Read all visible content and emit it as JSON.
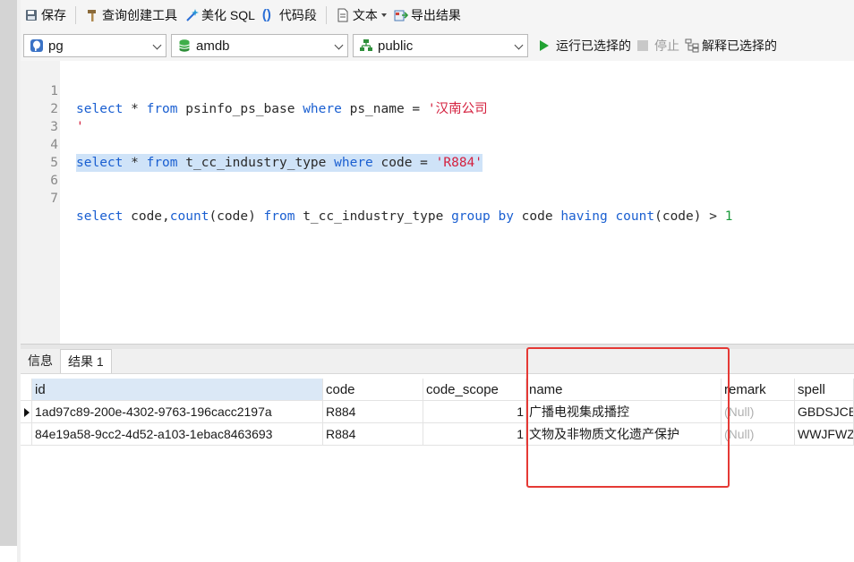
{
  "toolbar": {
    "save": "保存",
    "query_builder": "查询创建工具",
    "beautify_sql": "美化 SQL",
    "code_snippet": "代码段",
    "text": "文本",
    "export_results": "导出结果"
  },
  "selectors": {
    "connection": "pg",
    "database": "amdb",
    "schema": "public",
    "run_selected": "运行已选择的",
    "stop": "停止",
    "explain_selected": "解释已选择的"
  },
  "editor": {
    "lines": [
      {
        "num": "1"
      },
      {
        "num": "2"
      },
      {
        "num": "3"
      },
      {
        "num": "4"
      },
      {
        "num": "5"
      },
      {
        "num": "6"
      },
      {
        "num": "7"
      }
    ],
    "line1": {
      "select": "select",
      "star": " * ",
      "from": "from",
      "t1": " psinfo_ps_base ",
      "where": "where",
      "t2": " ps_name = ",
      "str": "'汉南公司"
    },
    "line2": {
      "str": "'"
    },
    "line4": {
      "select": "select",
      "star": " * ",
      "from": "from",
      "t1": " t_cc_industry_type ",
      "where": "where",
      "t2": " code = ",
      "str": "'R884'"
    },
    "line7": {
      "select": "select",
      "t1": " code,",
      "count1": "count",
      "t2": "(code) ",
      "from": "from",
      "t3": " t_cc_industry_type ",
      "group": "group",
      "sp1": " ",
      "by": "by",
      "t4": " code ",
      "having": "having",
      "sp2": " ",
      "count2": "count",
      "t5": "(code) > ",
      "num": "1"
    }
  },
  "result_tabs": {
    "info": "信息",
    "result1": "结果 1"
  },
  "grid": {
    "headers": {
      "id": "id",
      "code": "code",
      "code_scope": "code_scope",
      "name": "name",
      "remark": "remark",
      "spell": "spell"
    },
    "rows": [
      {
        "id": "1ad97c89-200e-4302-9763-196cacc2197a",
        "code": "R884",
        "code_scope": "1",
        "name": "广播电视集成播控",
        "remark": "(Null)",
        "spell": "GBDSJCB"
      },
      {
        "id": "84e19a58-9cc2-4d52-a103-1ebac8463693",
        "code": "R884",
        "code_scope": "1",
        "name": "文物及非物质文化遗产保护",
        "remark": "(Null)",
        "spell": "WWJFWZ"
      }
    ]
  },
  "colors": {
    "keyword": "#1a5fd1",
    "string": "#d4203e",
    "number": "#1a9a3a",
    "selection": "#cfe3f8",
    "annotation": "#e53935"
  },
  "icons": [
    "save-icon",
    "hammer-icon",
    "magic-wand-icon",
    "braces-icon",
    "document-icon",
    "export-icon",
    "postgres-icon",
    "database-icon",
    "schema-icon",
    "play-icon",
    "stop-icon",
    "explain-icon"
  ]
}
